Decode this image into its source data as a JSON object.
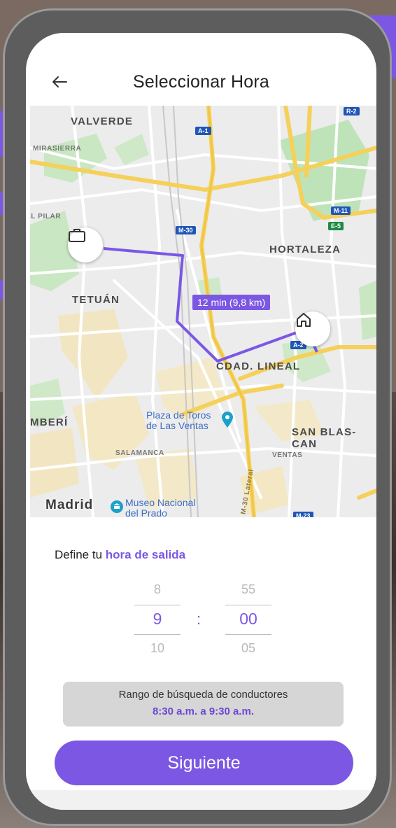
{
  "header": {
    "title": "Seleccionar Hora",
    "back_icon": "arrow-left-icon"
  },
  "map": {
    "labels": {
      "valverde": "VALVERDE",
      "mirasierra": "MIRASIERRA",
      "el_pilar": "EL PILAR",
      "hortaleza": "HORTALEZA",
      "tetuan": "TETUÁN",
      "cdad_lineal": "CDAD. LINEAL",
      "chamberi": "MBERÍ",
      "san_blas": "SAN BLAS-CAN",
      "salamanca": "SALAMANCA",
      "ventas": "VENTAS",
      "plaza_toros": "Plaza de Toros de Las Ventas",
      "museo_prado": "Museo Nacional del Prado",
      "madrid": "Madrid"
    },
    "road_shields": [
      "R-2",
      "A-1",
      "M-11",
      "E-5",
      "M-30",
      "A-2",
      "M-23"
    ],
    "lateral_label": "M-30 Lateral",
    "route_badge": "12 min (9,8 km)",
    "origin_icon": "briefcase-icon",
    "destination_icon": "home-icon",
    "route_color": "#7b57e4"
  },
  "form": {
    "define_prefix": "Define tu",
    "define_accent": "hora de salida",
    "hour": {
      "prev": "8",
      "selected": "9",
      "next": "10"
    },
    "minute": {
      "prev": "55",
      "selected": "00",
      "next": "05"
    },
    "separator": ":",
    "range_label": "Rango de búsqueda de conductores",
    "range_value": "8:30 a.m. a 9:30 a.m.",
    "next_button": "Siguiente"
  },
  "colors": {
    "accent": "#7b57e4",
    "background": "#ffffff",
    "range_box": "#d6d6d6"
  }
}
